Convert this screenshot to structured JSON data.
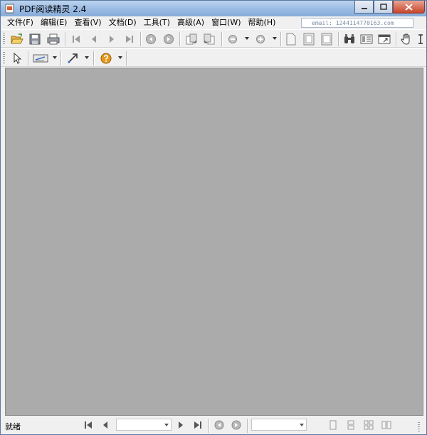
{
  "window": {
    "title": "PDF阅读精灵 2.4"
  },
  "menu": {
    "items": [
      "文件(F)",
      "编辑(E)",
      "查看(V)",
      "文档(D)",
      "工具(T)",
      "高级(A)",
      "窗口(W)",
      "帮助(H)"
    ]
  },
  "header": {
    "email": "email: 1244114770163.com"
  },
  "status": {
    "text": "就绪"
  },
  "colors": {
    "workspace": "#ababab",
    "titlebar": "#9fbfe6",
    "help_icon": "#e39a1c"
  }
}
